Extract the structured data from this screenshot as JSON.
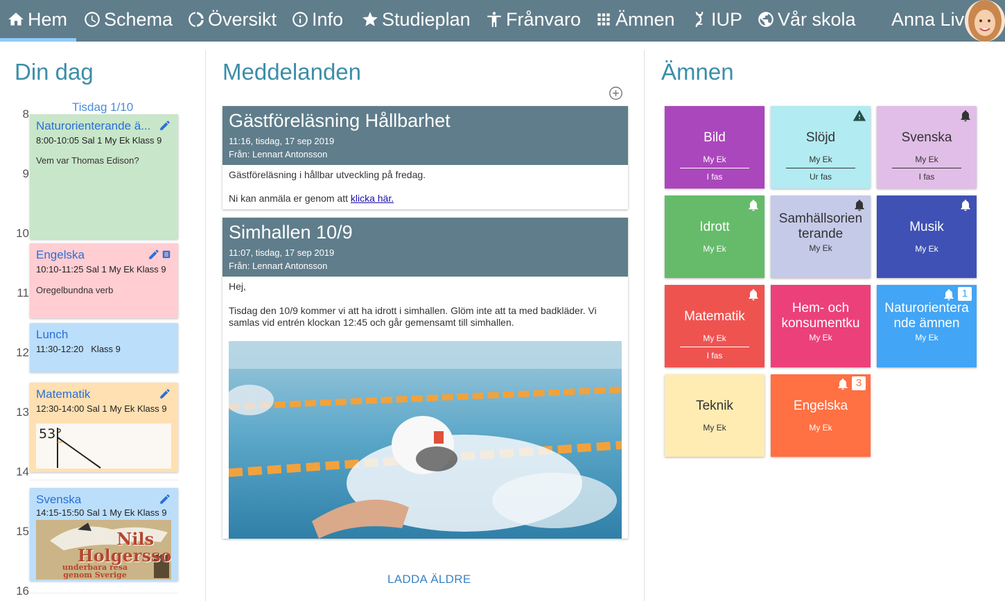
{
  "nav": {
    "items": [
      {
        "label": "Hem",
        "icon": "home-icon"
      },
      {
        "label": "Schema",
        "icon": "clock-icon"
      },
      {
        "label": "Översikt",
        "icon": "donut-icon"
      },
      {
        "label": "Info",
        "icon": "info-icon"
      },
      {
        "label": "Studieplan",
        "icon": "star-icon"
      },
      {
        "label": "Frånvaro",
        "icon": "person-icon"
      },
      {
        "label": "Ämnen",
        "icon": "grid-icon"
      },
      {
        "label": "IUP",
        "icon": "dna-icon"
      },
      {
        "label": "Vår skola",
        "icon": "globe-icon"
      }
    ],
    "user_name": "Anna Liv"
  },
  "day": {
    "title": "Din dag",
    "date_label": "Tisdag 1/10",
    "hours": [
      "8",
      "9",
      "10",
      "11",
      "12",
      "13",
      "14",
      "15",
      "16"
    ],
    "events": [
      {
        "title": "Naturorienterande ä...",
        "time": "8:00-10:05 Sal 1 My Ek Klass 9",
        "note": "Vem var Thomas Edison?"
      },
      {
        "title": "Engelska",
        "time": "10:10-11:25 Sal 1 My Ek Klass 9",
        "note": "Oregelbundna verb"
      },
      {
        "title": "Lunch",
        "time": "11:30-12:20   Klass 9",
        "note": ""
      },
      {
        "title": "Matematik",
        "time": "12:30-14:00 Sal 1 My Ek Klass 9",
        "note": "53°"
      },
      {
        "title": "Svenska",
        "time": "14:15-15:50 Sal 1 My Ek Klass 9",
        "note": "Nils Holgerssons underbara resa genom Sverige"
      }
    ]
  },
  "messages": {
    "title": "Meddelanden",
    "items": [
      {
        "title": "Gästföreläsning Hållbarhet",
        "time": "11:16, tisdag, 17 sep 2019",
        "from": "Från: Lennart Antonsson",
        "body1": "Gästföreläsning i hållbar utveckling på fredag.",
        "body2_prefix": "Ni kan anmäla er genom att ",
        "body2_link": "klicka här."
      },
      {
        "title": "Simhallen 10/9",
        "time": "11:07, tisdag, 17 sep 2019",
        "from": "Från: Lennart Antonsson",
        "body1": "Hej,",
        "body2": "Tisdag den 10/9 kommer vi att ha idrott i simhallen. Glöm inte att ta med badkläder. Vi samlas vid entrén klockan 12:45 och går gemensamt till simhallen."
      }
    ],
    "load_older": "LADDA ÄLDRE"
  },
  "subjects": {
    "title": "Ämnen",
    "tiles": [
      {
        "name": "Bild",
        "teacher": "My Ek",
        "phase": "I fas",
        "color": "#ab47bc",
        "text": "#ffffff",
        "icon": ""
      },
      {
        "name": "Slöjd",
        "teacher": "My Ek",
        "phase": "Ur fas",
        "color": "#b2ebf2",
        "text": "#333333",
        "icon": "warning-icon"
      },
      {
        "name": "Svenska",
        "teacher": "My Ek",
        "phase": "I fas",
        "color": "#e1bee7",
        "text": "#333333",
        "icon": "bell-icon"
      },
      {
        "name": "Idrott",
        "teacher": "My Ek",
        "phase": "",
        "color": "#66bb6a",
        "text": "#ffffff",
        "icon": "bell-icon"
      },
      {
        "name": "Samhällsorien terande",
        "teacher": "My Ek",
        "phase": "",
        "color": "#c5cae9",
        "text": "#333333",
        "icon": "bell-icon"
      },
      {
        "name": "Musik",
        "teacher": "My Ek",
        "phase": "",
        "color": "#3f51b5",
        "text": "#ffffff",
        "icon": "bell-icon"
      },
      {
        "name": "Matematik",
        "teacher": "My Ek",
        "phase": "I fas",
        "color": "#ef5350",
        "text": "#ffffff",
        "icon": "bell-icon"
      },
      {
        "name": "Hem- och konsumentku",
        "teacher": "My Ek",
        "phase": "",
        "color": "#ec407a",
        "text": "#ffffff",
        "icon": ""
      },
      {
        "name": "Naturorientera nde ämnen",
        "teacher": "My Ek",
        "phase": "",
        "color": "#42a5f5",
        "text": "#ffffff",
        "icon": "bell-icon",
        "badge": "1"
      },
      {
        "name": "Teknik",
        "teacher": "My Ek",
        "phase": "",
        "color": "#ffecb3",
        "text": "#333333",
        "icon": ""
      },
      {
        "name": "Engelska",
        "teacher": "My Ek",
        "phase": "",
        "color": "#ff7043",
        "text": "#ffffff",
        "icon": "bell-icon",
        "badge": "3"
      }
    ]
  }
}
